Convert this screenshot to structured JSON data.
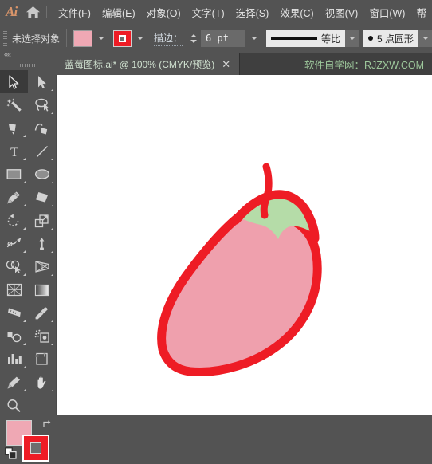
{
  "app": {
    "logo": "Ai",
    "home_icon": "home-icon"
  },
  "menubar": {
    "items": [
      {
        "label": "文件(F)"
      },
      {
        "label": "编辑(E)"
      },
      {
        "label": "对象(O)"
      },
      {
        "label": "文字(T)"
      },
      {
        "label": "选择(S)"
      },
      {
        "label": "效果(C)"
      },
      {
        "label": "视图(V)"
      },
      {
        "label": "窗口(W)"
      },
      {
        "label": "帮"
      }
    ]
  },
  "controlbar": {
    "selection_status": "未选择对象",
    "fill_color": "#efa8b4",
    "stroke_color": "#ee1c25",
    "stroke_label": "描边：",
    "stroke_weight": "6 pt",
    "stroke_profile": "等比",
    "brush_definition": "5 点圆形"
  },
  "tabbar": {
    "document_title": "蓝莓图标.ai* @ 100% (CMYK/预览)",
    "close_label": "✕",
    "watermark": "软件自学网：RJZXW.COM"
  },
  "toolpanel": {
    "collapse_label": "««",
    "tools": [
      {
        "name": "selection-tool",
        "active": true
      },
      {
        "name": "direct-selection-tool",
        "active": false
      },
      {
        "name": "magic-wand-tool",
        "active": false
      },
      {
        "name": "lasso-tool",
        "active": false
      },
      {
        "name": "pen-tool",
        "active": false
      },
      {
        "name": "curvature-tool",
        "active": false
      },
      {
        "name": "type-tool",
        "active": false
      },
      {
        "name": "line-segment-tool",
        "active": false
      },
      {
        "name": "rectangle-tool",
        "active": false
      },
      {
        "name": "ellipse-tool",
        "active": false
      },
      {
        "name": "paintbrush-tool",
        "active": false
      },
      {
        "name": "eraser-tool",
        "active": false
      },
      {
        "name": "rotate-tool",
        "active": false
      },
      {
        "name": "scale-tool",
        "active": false
      },
      {
        "name": "width-tool",
        "active": false
      },
      {
        "name": "free-transform-tool",
        "active": false
      },
      {
        "name": "shape-builder-tool",
        "active": false
      },
      {
        "name": "perspective-grid-tool",
        "active": false
      },
      {
        "name": "mesh-tool",
        "active": false
      },
      {
        "name": "gradient-tool",
        "active": false
      },
      {
        "name": "measure-tool",
        "active": false
      },
      {
        "name": "eyedropper-tool",
        "active": false
      },
      {
        "name": "blend-tool",
        "active": false
      },
      {
        "name": "symbol-sprayer-tool",
        "active": false
      },
      {
        "name": "column-graph-tool",
        "active": false
      },
      {
        "name": "artboard-tool",
        "active": false
      },
      {
        "name": "slice-tool",
        "active": false
      },
      {
        "name": "hand-tool",
        "active": false
      },
      {
        "name": "zoom-tool",
        "active": false
      }
    ],
    "fill_swatch_color": "#efa8b4",
    "stroke_swatch_color": "#ee1c25",
    "swap_icon": "swap-fill-stroke-icon",
    "default_icon": "default-fill-stroke-icon"
  },
  "artwork": {
    "name": "chili-pepper-illustration",
    "body_fill": "#efa0ad",
    "outline_stroke": "#ee1c25",
    "calyx_fill": "#b5dca8",
    "stem_stroke": "#ee1c25",
    "canvas_background": "#ffffff"
  }
}
